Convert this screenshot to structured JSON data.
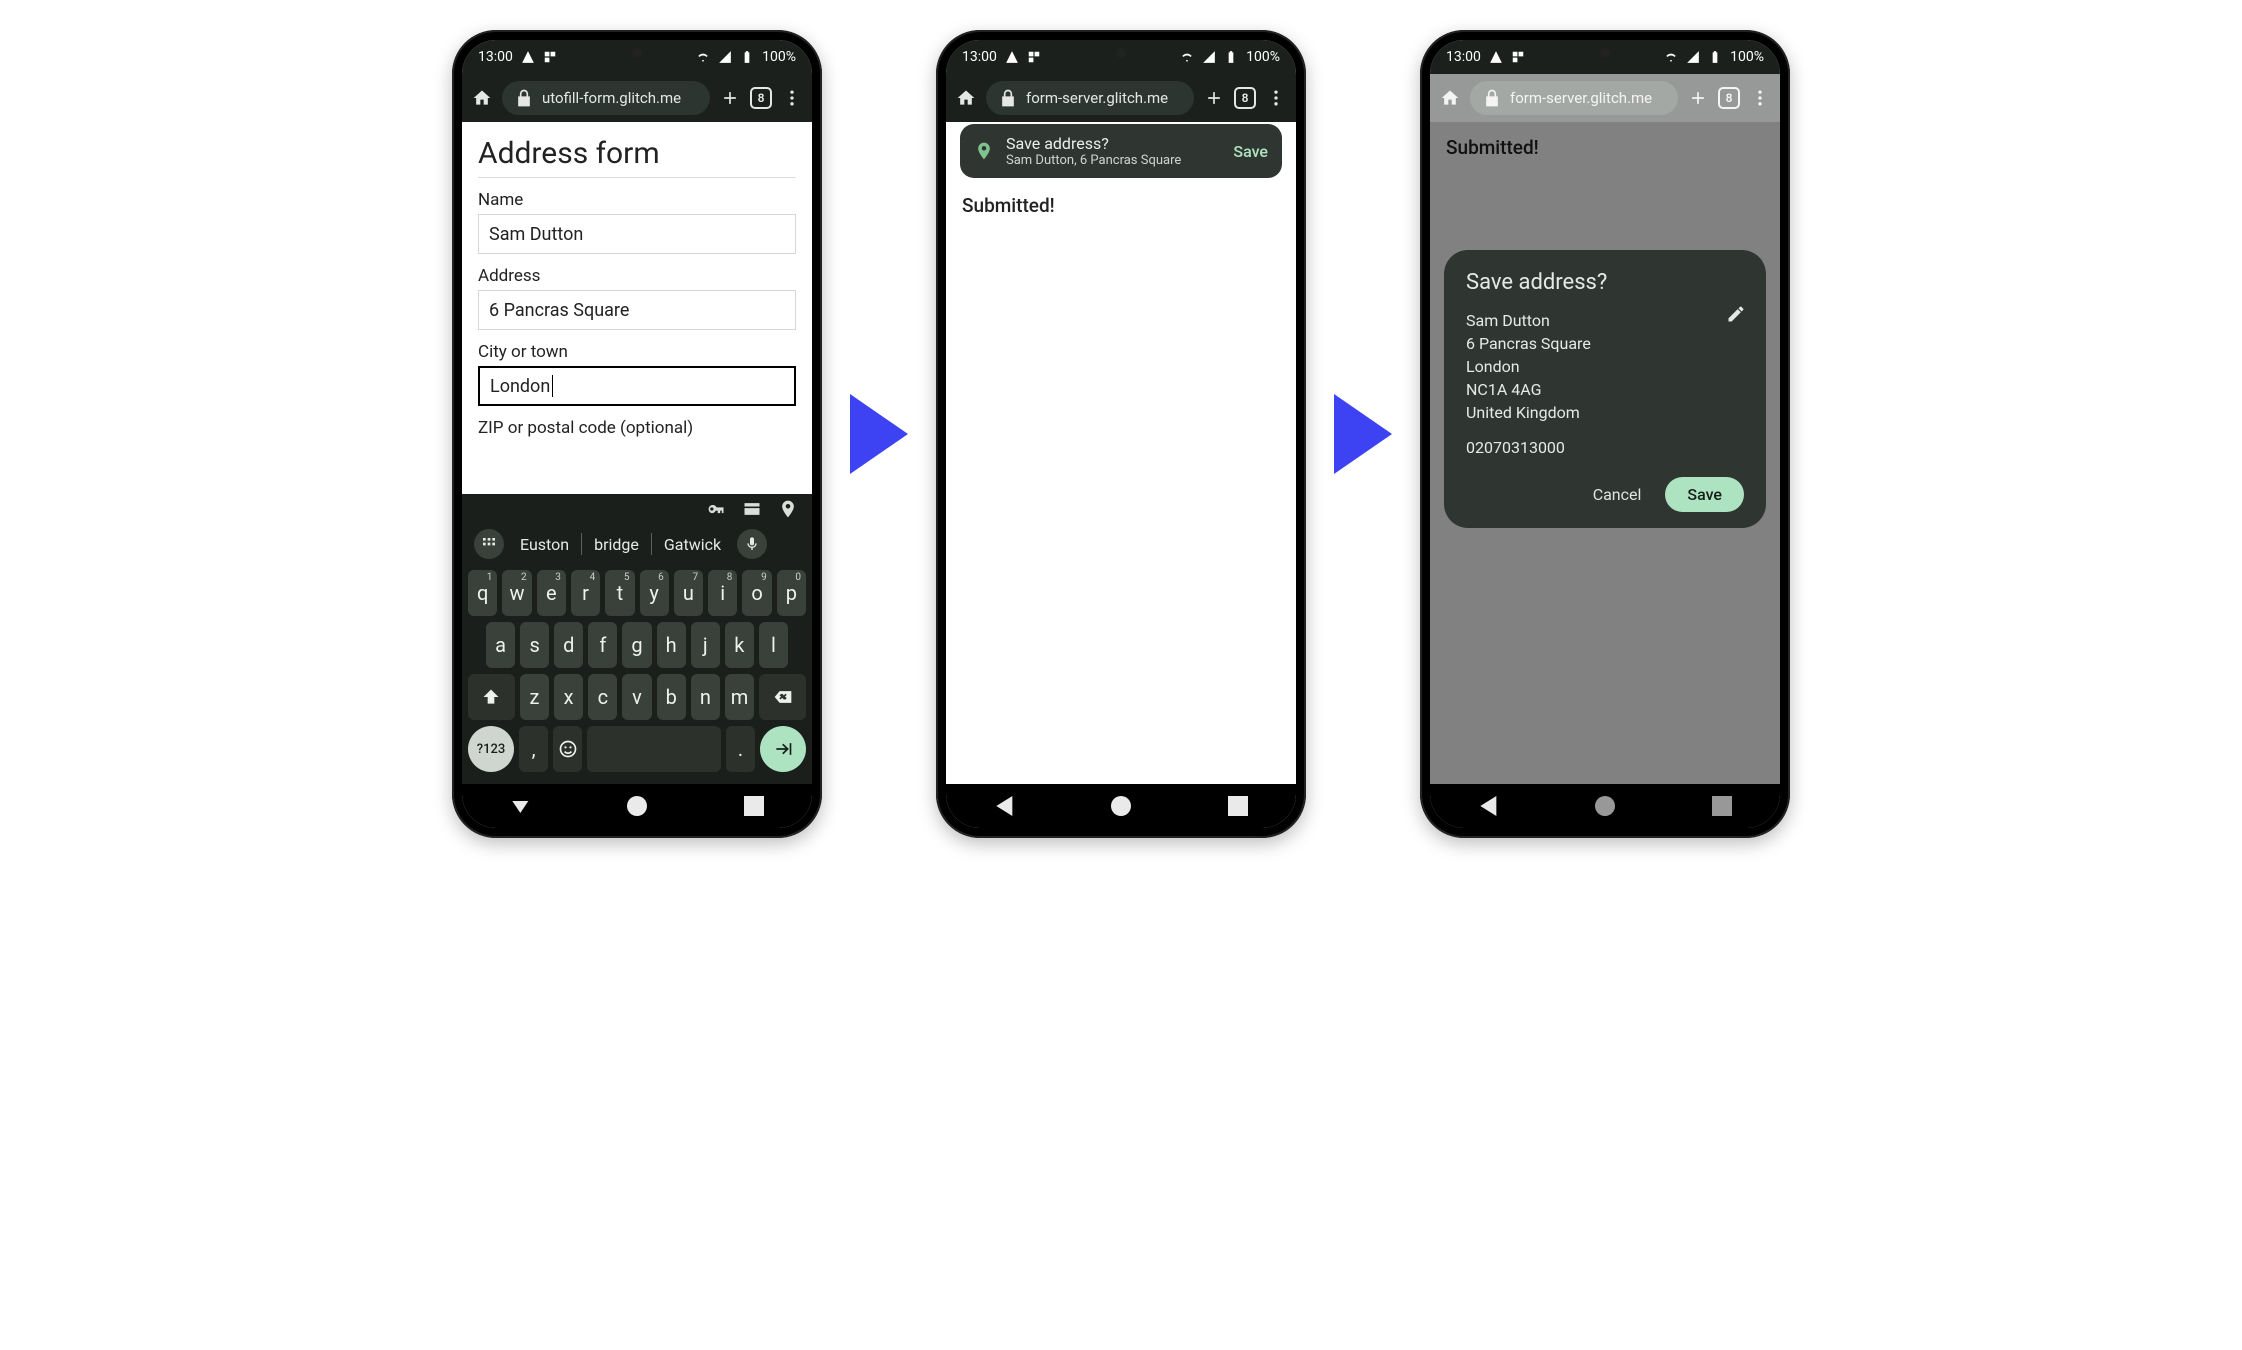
{
  "status": {
    "time": "13:00",
    "battery": "100%"
  },
  "tabcount": "8",
  "arrow_color": "#3d42f3",
  "phone1": {
    "url": "utofill-form.glitch.me",
    "page_title": "Address form",
    "fields": {
      "name": {
        "label": "Name",
        "value": "Sam Dutton"
      },
      "address": {
        "label": "Address",
        "value": "6 Pancras Square"
      },
      "city": {
        "label": "City or town",
        "value": "London"
      },
      "postal": {
        "label": "ZIP or postal code (optional)",
        "value": ""
      }
    },
    "keyboard": {
      "suggestions": [
        "Euston",
        "bridge",
        "Gatwick"
      ],
      "row1": [
        {
          "k": "q",
          "s": "1"
        },
        {
          "k": "w",
          "s": "2"
        },
        {
          "k": "e",
          "s": "3"
        },
        {
          "k": "r",
          "s": "4"
        },
        {
          "k": "t",
          "s": "5"
        },
        {
          "k": "y",
          "s": "6"
        },
        {
          "k": "u",
          "s": "7"
        },
        {
          "k": "i",
          "s": "8"
        },
        {
          "k": "o",
          "s": "9"
        },
        {
          "k": "p",
          "s": "0"
        }
      ],
      "row2": [
        "a",
        "s",
        "d",
        "f",
        "g",
        "h",
        "j",
        "k",
        "l"
      ],
      "row3": [
        "z",
        "x",
        "c",
        "v",
        "b",
        "n",
        "m"
      ],
      "symkey": "?123",
      "comma": ",",
      "period": "."
    }
  },
  "phone2": {
    "url": "form-server.glitch.me",
    "body": "Submitted!",
    "banner": {
      "title": "Save address?",
      "subtitle": "Sam Dutton, 6 Pancras Square",
      "action": "Save"
    }
  },
  "phone3": {
    "url": "form-server.glitch.me",
    "body": "Submitted!",
    "modal": {
      "title": "Save address?",
      "lines": [
        "Sam Dutton",
        "6 Pancras Square",
        "London",
        "NC1A 4AG",
        "United Kingdom"
      ],
      "phone": "02070313000",
      "cancel": "Cancel",
      "save": "Save"
    }
  }
}
